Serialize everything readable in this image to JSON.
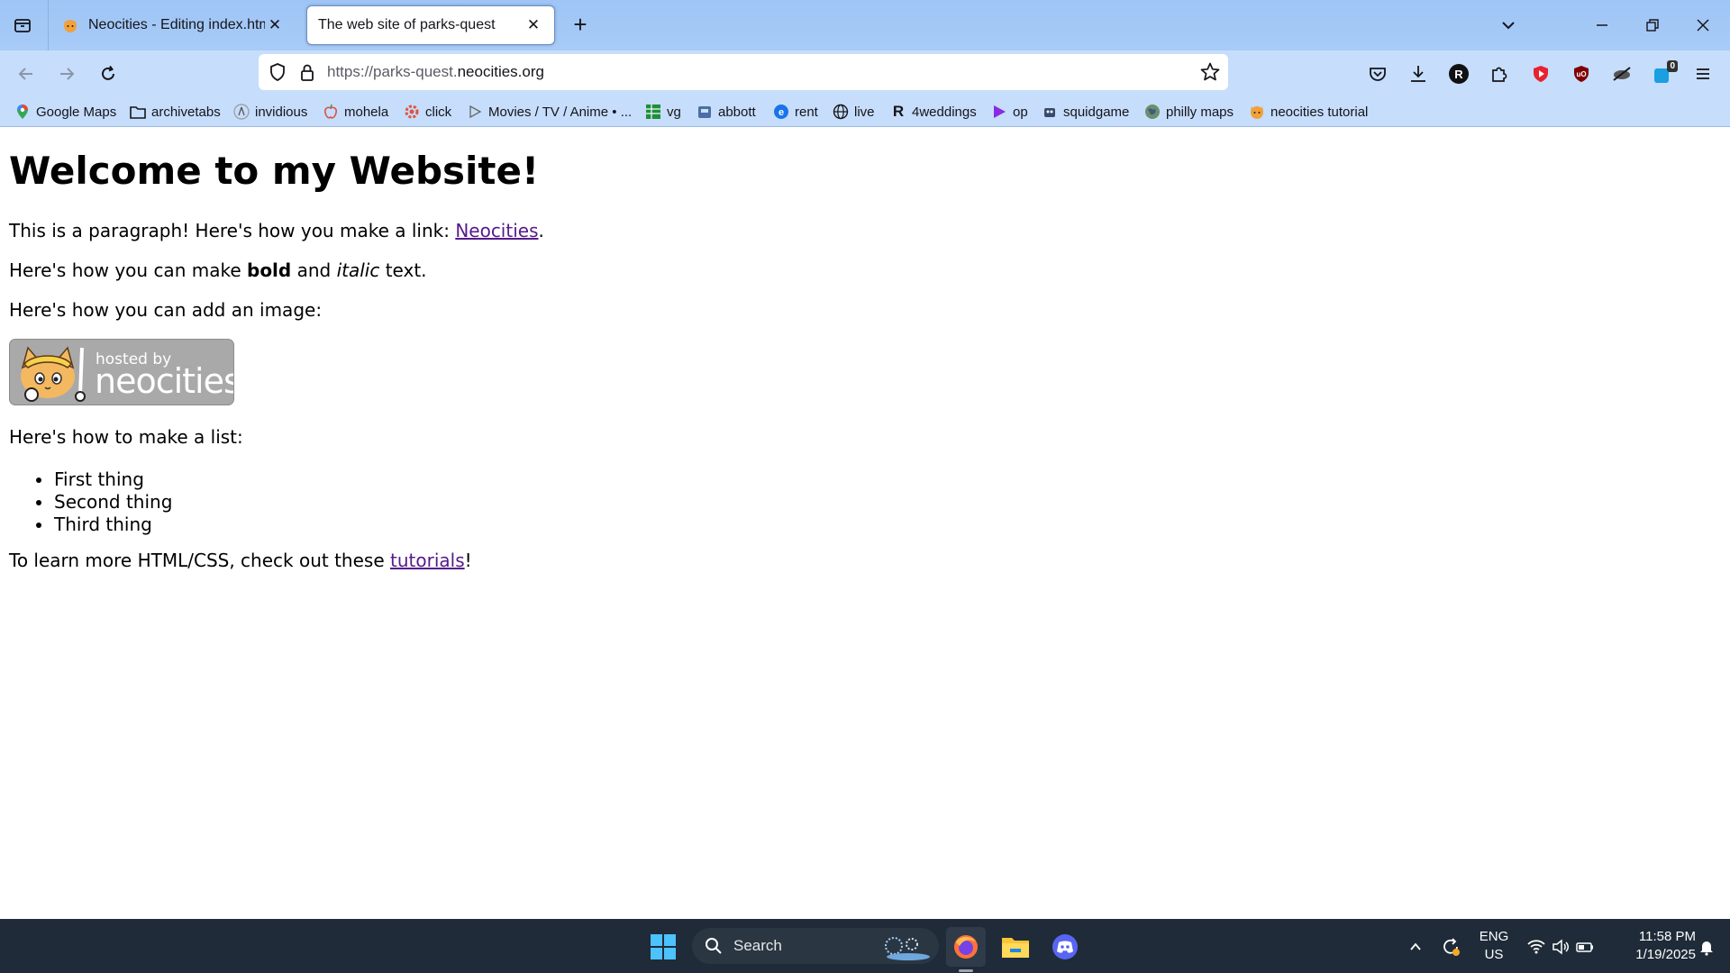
{
  "browser": {
    "tabs": [
      {
        "title": "Neocities - Editing index.html",
        "active": false
      },
      {
        "title": "The web site of parks-quest",
        "active": true
      }
    ],
    "url": {
      "prefix": "https://parks-quest.",
      "domain": "neocities.org"
    },
    "bookmarks": [
      {
        "label": "Google Maps",
        "icon": "map-pin-icon"
      },
      {
        "label": "archivetabs",
        "icon": "folder-icon"
      },
      {
        "label": "invidious",
        "icon": "invidious-icon"
      },
      {
        "label": "mohela",
        "icon": "apple-icon"
      },
      {
        "label": "click",
        "icon": "gear-icon"
      },
      {
        "label": "Movies / TV / Anime • ...",
        "icon": "play-outline-icon"
      },
      {
        "label": "vg",
        "icon": "grid-icon"
      },
      {
        "label": "abbott",
        "icon": "tile-icon"
      },
      {
        "label": "rent",
        "icon": "circle-e-icon"
      },
      {
        "label": "live",
        "icon": "globe-icon"
      },
      {
        "label": "4weddings",
        "icon": "r-letter-icon"
      },
      {
        "label": "op",
        "icon": "play-icon"
      },
      {
        "label": "squidgame",
        "icon": "figure-icon"
      },
      {
        "label": "philly maps",
        "icon": "globe-map-icon"
      },
      {
        "label": "neocities tutorial",
        "icon": "cat-icon"
      }
    ],
    "extension_badge": "0"
  },
  "page": {
    "heading": "Welcome to my Website!",
    "p1_text": "This is a paragraph! Here's how you make a link: ",
    "p1_link": "Neocities",
    "p1_end": ".",
    "p2_a": "Here's how you can make ",
    "p2_bold": "bold",
    "p2_b": " and ",
    "p2_italic": "italic",
    "p2_c": " text.",
    "p3": "Here's how you can add an image:",
    "badge_hosted": "hosted by",
    "badge_name": "neocities",
    "p4": "Here's how to make a list:",
    "list": [
      "First thing",
      "Second thing",
      "Third thing"
    ],
    "p5_text": "To learn more HTML/CSS, check out these ",
    "p5_link": "tutorials",
    "p5_end": "!"
  },
  "taskbar": {
    "search_label": "Search",
    "lang": "ENG",
    "region": "US",
    "time": "11:58 PM",
    "date": "1/19/2025"
  },
  "colors": {
    "tabbar": "#a8cbf7",
    "navbar": "#c6ddfb",
    "visited_link": "#551a8b",
    "taskbar": "#1f2b38"
  }
}
